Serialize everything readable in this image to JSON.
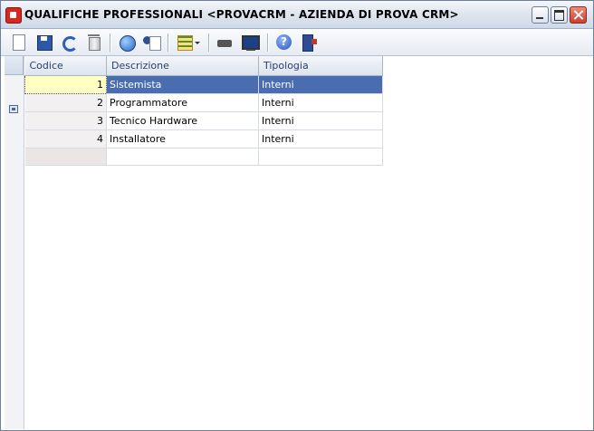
{
  "window": {
    "title": "QUALIFICHE PROFESSIONALI <PROVACRM - AZIENDA DI PROVA CRM>"
  },
  "toolbar": {
    "icons": [
      "new-document-icon",
      "save-icon",
      "undo-icon",
      "trash-icon",
      "globe-icon",
      "contact-card-icon",
      "list-options-icon",
      "print-icon",
      "monitor-icon",
      "help-icon",
      "exit-icon"
    ]
  },
  "table": {
    "columns": [
      "Codice",
      "Descrizione",
      "Tipologia"
    ],
    "rows": [
      {
        "codice": "1",
        "descrizione": "Sistemista",
        "tipologia": "Interni"
      },
      {
        "codice": "2",
        "descrizione": "Programmatore",
        "tipologia": "Interni"
      },
      {
        "codice": "3",
        "descrizione": "Tecnico Hardware",
        "tipologia": "Interni"
      },
      {
        "codice": "4",
        "descrizione": "Installatore",
        "tipologia": "Interni"
      }
    ],
    "selected_row": 0
  },
  "colors": {
    "selection": "#4a6db1",
    "active_cell": "#ffffc2",
    "header_text": "#2b4070"
  }
}
